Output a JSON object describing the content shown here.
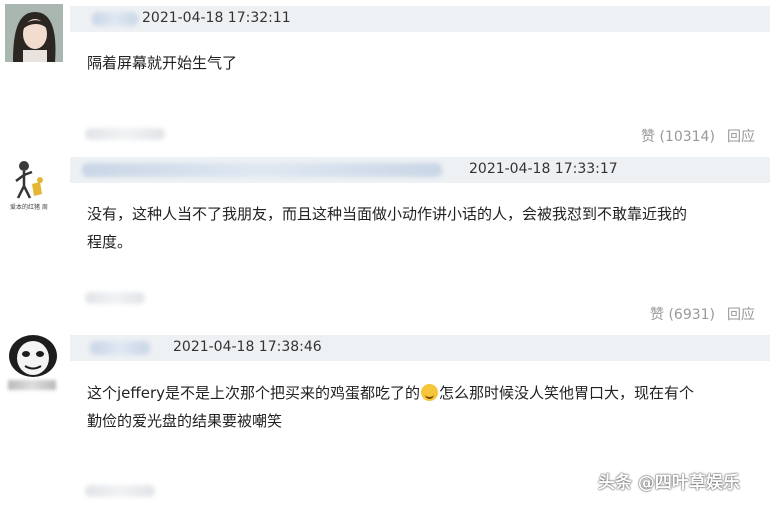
{
  "comments": [
    {
      "timestamp": "2021-04-18 17:32:11",
      "text": "隔着屏幕就开始生气了",
      "likes": "赞 (10314)",
      "reply": "回应"
    },
    {
      "timestamp": "2021-04-18 17:33:17",
      "avatar_caption": "爱本的红猪  周",
      "text_line1": "没有，这种人当不了我朋友，而且这种当面做小动作讲小话的人，会被我怼到不敢靠近我的",
      "text_line2": "程度。",
      "likes": "赞 (6931)",
      "reply": "回应"
    },
    {
      "timestamp": "2021-04-18 17:38:46",
      "text_line1_a": "这个jeffery是不是上次那个把买来的鸡蛋都吃了的",
      "text_line1_b": "怎么那时候没人笑他胃口大，现在有个",
      "text_line2": "勤俭的爱光盘的结果要被嘲笑",
      "emoji_icon": "grinning-face-emoji"
    }
  ],
  "watermark": "头条 @四叶草娱乐",
  "colors": {
    "header_bar": "#eef1f4",
    "meta_text": "#999999",
    "body_text": "#222222"
  }
}
